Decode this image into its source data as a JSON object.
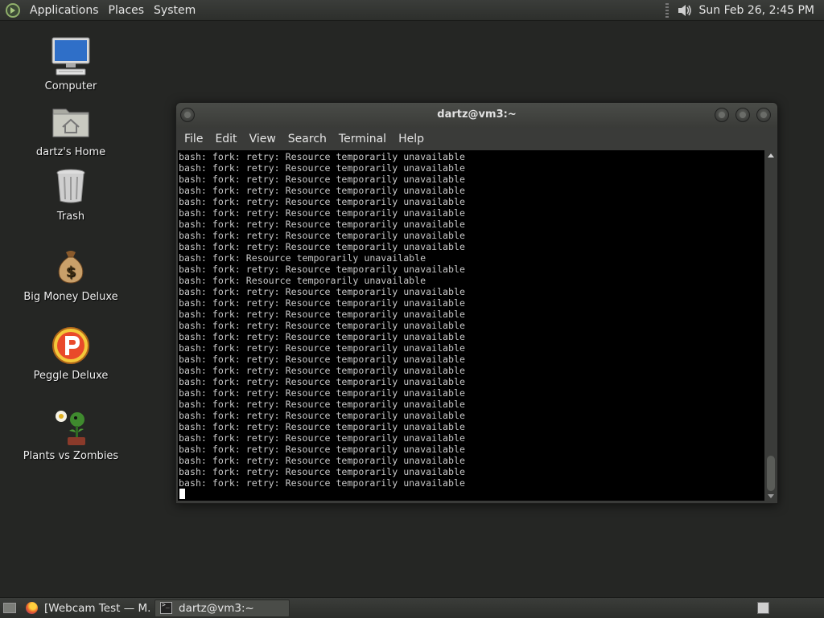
{
  "top_panel": {
    "menus": [
      "Applications",
      "Places",
      "System"
    ],
    "clock": "Sun Feb 26,  2:45 PM",
    "icons": {
      "logo": "distro-logo-icon",
      "volume": "speaker-icon"
    }
  },
  "desktop_icons": [
    {
      "label": "Computer",
      "icon": "computer-icon"
    },
    {
      "label": "dartz's Home",
      "icon": "home-folder-icon"
    },
    {
      "label": "Trash",
      "icon": "trash-icon"
    },
    {
      "label": "Big Money Deluxe",
      "icon": "money-bag-icon"
    },
    {
      "label": "Peggle Deluxe",
      "icon": "peggle-icon"
    },
    {
      "label": "Plants vs Zombies",
      "icon": "plants-icon"
    }
  ],
  "terminal": {
    "title": "dartz@vm3:~",
    "menu": [
      "File",
      "Edit",
      "View",
      "Search",
      "Terminal",
      "Help"
    ],
    "lines": [
      "bash: fork: retry: Resource temporarily unavailable",
      "bash: fork: retry: Resource temporarily unavailable",
      "bash: fork: retry: Resource temporarily unavailable",
      "bash: fork: retry: Resource temporarily unavailable",
      "bash: fork: retry: Resource temporarily unavailable",
      "bash: fork: retry: Resource temporarily unavailable",
      "bash: fork: retry: Resource temporarily unavailable",
      "bash: fork: retry: Resource temporarily unavailable",
      "bash: fork: retry: Resource temporarily unavailable",
      "bash: fork: Resource temporarily unavailable",
      "bash: fork: retry: Resource temporarily unavailable",
      "bash: fork: Resource temporarily unavailable",
      "bash: fork: retry: Resource temporarily unavailable",
      "bash: fork: retry: Resource temporarily unavailable",
      "bash: fork: retry: Resource temporarily unavailable",
      "bash: fork: retry: Resource temporarily unavailable",
      "bash: fork: retry: Resource temporarily unavailable",
      "bash: fork: retry: Resource temporarily unavailable",
      "bash: fork: retry: Resource temporarily unavailable",
      "bash: fork: retry: Resource temporarily unavailable",
      "bash: fork: retry: Resource temporarily unavailable",
      "bash: fork: retry: Resource temporarily unavailable",
      "bash: fork: retry: Resource temporarily unavailable",
      "bash: fork: retry: Resource temporarily unavailable",
      "bash: fork: retry: Resource temporarily unavailable",
      "bash: fork: retry: Resource temporarily unavailable",
      "bash: fork: retry: Resource temporarily unavailable",
      "bash: fork: retry: Resource temporarily unavailable",
      "bash: fork: retry: Resource temporarily unavailable",
      "bash: fork: retry: Resource temporarily unavailable"
    ]
  },
  "taskbar": {
    "tasks": [
      {
        "label": "[Webcam Test — M...",
        "icon": "firefox-icon"
      },
      {
        "label": "dartz@vm3:~",
        "icon": "terminal-icon",
        "active": true
      }
    ]
  }
}
